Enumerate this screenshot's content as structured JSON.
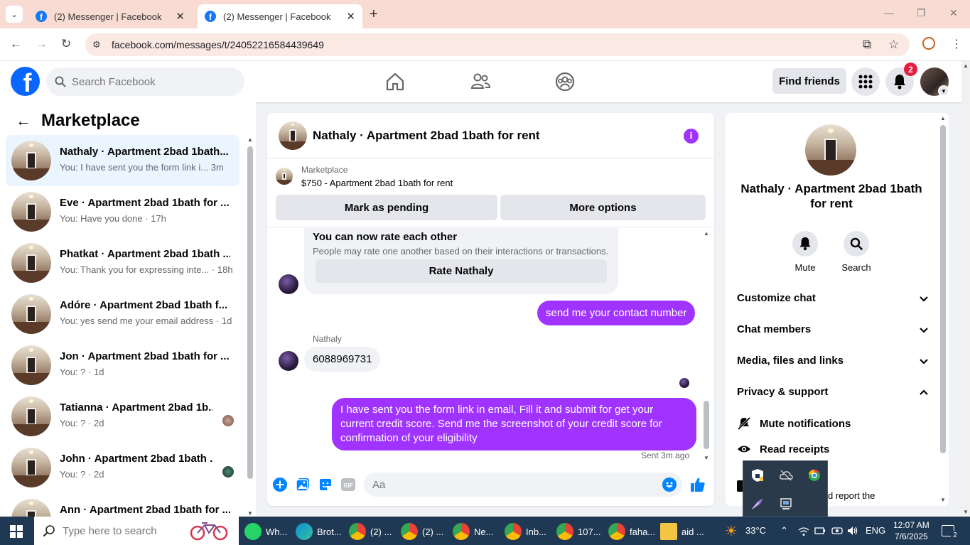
{
  "browser": {
    "tabs": [
      {
        "title": "(2) Messenger | Facebook",
        "active": false
      },
      {
        "title": "(2) Messenger | Facebook",
        "active": true
      }
    ],
    "url": "facebook.com/messages/t/24052216584439649"
  },
  "fb_header": {
    "search_placeholder": "Search Facebook",
    "find_friends": "Find friends",
    "notification_count": "2"
  },
  "left_panel": {
    "title": "Marketplace",
    "conversations": [
      {
        "name": "Nathaly · Apartment 2bad 1bath...",
        "preview": "You: I have sent you the form link i...",
        "time": "3m"
      },
      {
        "name": "Eve · Apartment 2bad 1bath for ...",
        "preview": "You: Have you done",
        "time": "17h"
      },
      {
        "name": "Phatkat · Apartment 2bad 1bath ...",
        "preview": "You: Thank you for expressing inte...",
        "time": "18h"
      },
      {
        "name": "Adóre · Apartment 2bad 1bath f...",
        "preview": "You: yes send me your email address",
        "time": "1d"
      },
      {
        "name": "Jon · Apartment 2bad 1bath for ...",
        "preview": "You: ?",
        "time": "1d"
      },
      {
        "name": "Tatianna · Apartment 2bad 1b...",
        "preview": "You: ?",
        "time": "2d"
      },
      {
        "name": "John · Apartment 2bad 1bath ...",
        "preview": "You: ?",
        "time": "2d"
      },
      {
        "name": "Ann · Apartment 2bad 1bath for ...",
        "preview": "",
        "time": ""
      }
    ]
  },
  "chat": {
    "title": "Nathaly · Apartment 2bad 1bath for rent",
    "marketplace_label": "Marketplace",
    "listing": "$750 - Apartment 2bad 1bath for rent",
    "mark_pending": "Mark as pending",
    "more_options": "More options",
    "rate_title": "You can now rate each other",
    "rate_sub": "People may rate one another based on their interactions or transactions.",
    "rate_button": "Rate Nathaly",
    "msg_out_1": "send me your contact number",
    "sender_name": "Nathaly",
    "msg_in_1": "6088969731",
    "msg_out_2": "I have sent you the form link in email, Fill it and submit for get your current credit score. Send me the screenshot of your credit score for confirmation of your eligibility",
    "sent_status": "Sent 3m ago",
    "composer_placeholder": "Aa",
    "gif_label": "GIF"
  },
  "right_panel": {
    "name": "Nathaly · Apartment 2bad 1bath for rent",
    "mute": "Mute",
    "search": "Search",
    "sections": [
      "Customize chat",
      "Chat members",
      "Media, files and links",
      "Privacy & support"
    ],
    "mute_notifications": "Mute notifications",
    "read_receipts": "Read receipts",
    "truncated": "d report the"
  },
  "taskbar": {
    "search_placeholder": "Type here to search",
    "apps": [
      {
        "label": "Wh...",
        "color": "#25d366"
      },
      {
        "label": "Brot...",
        "color": "#0c8fd4"
      },
      {
        "label": "(2) ...",
        "color": "#34a853"
      },
      {
        "label": "(2) ...",
        "color": "#34a853"
      },
      {
        "label": "Ne...",
        "color": "#34a853"
      },
      {
        "label": "Inb...",
        "color": "#34a853"
      },
      {
        "label": "107...",
        "color": "#34a853"
      },
      {
        "label": "faha...",
        "color": "#34a853"
      },
      {
        "label": "aid ...",
        "color": "#f4c542"
      }
    ],
    "temperature": "33°C",
    "language": "ENG",
    "time": "12:07 AM",
    "date": "7/6/2025",
    "notification_count": "2"
  }
}
